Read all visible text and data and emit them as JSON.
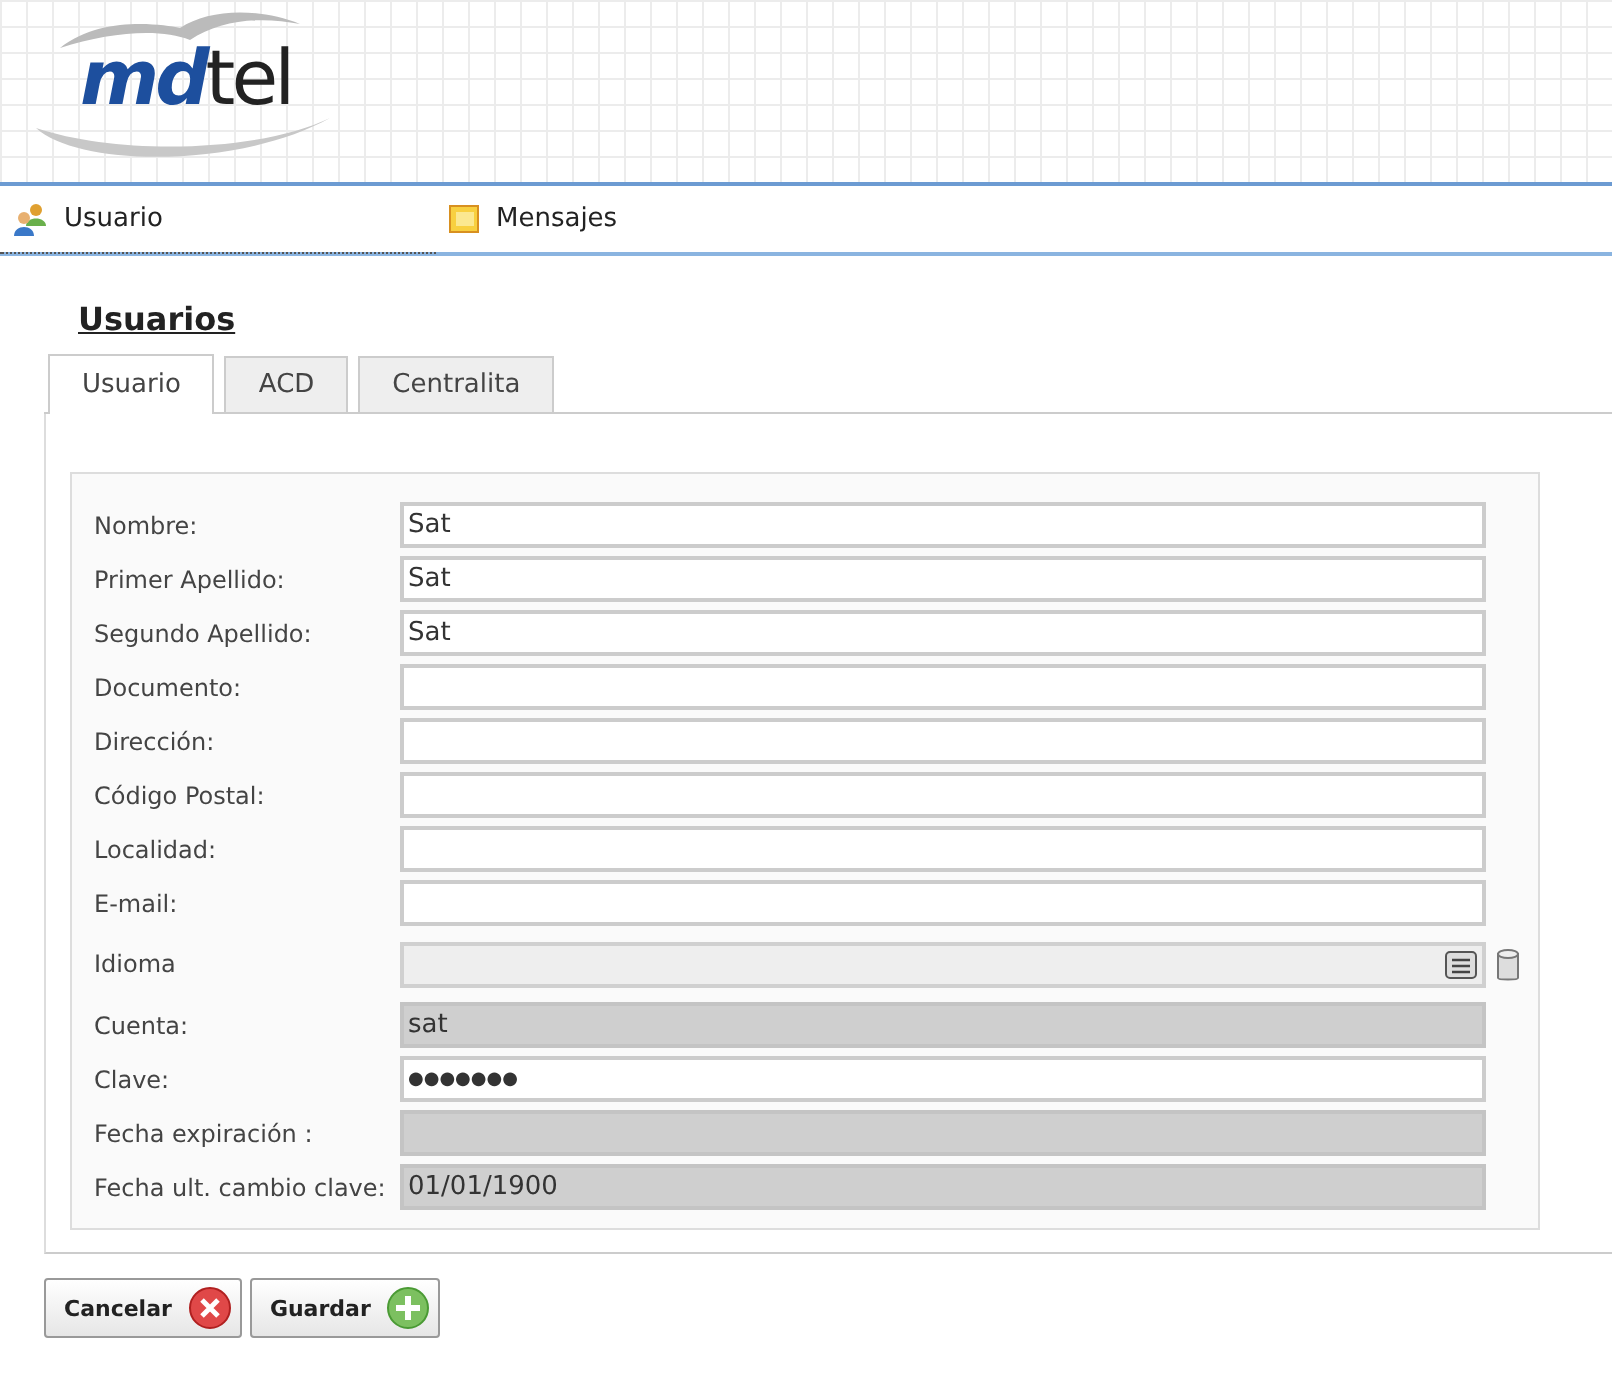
{
  "logo": {
    "part_1": "md",
    "part_2": "tel"
  },
  "nav": [
    {
      "label": "Usuario",
      "kind": "users",
      "selected": true
    },
    {
      "label": "Mensajes",
      "kind": "message",
      "selected": false
    }
  ],
  "title": "Usuarios",
  "tabs": [
    {
      "label": "Usuario",
      "selected": true
    },
    {
      "label": "ACD",
      "selected": false
    },
    {
      "label": "Centralita",
      "selected": false
    }
  ],
  "fields": [
    {
      "label": "Nombre:",
      "value": "Sat",
      "kind": "text"
    },
    {
      "label": "Primer Apellido:",
      "value": "Sat",
      "kind": "text"
    },
    {
      "label": "Segundo Apellido:",
      "value": "Sat",
      "kind": "text"
    },
    {
      "label": "Documento:",
      "kind": "text"
    },
    {
      "label": "Dirección:",
      "kind": "text"
    },
    {
      "label": "Código Postal:",
      "kind": "text"
    },
    {
      "label": "Localidad:",
      "kind": "text"
    },
    {
      "label": "E-mail:",
      "kind": "text"
    },
    {
      "label": "Idioma",
      "kind": "lookup"
    },
    {
      "label": "Cuenta:",
      "value": "sat",
      "kind": "readonly"
    },
    {
      "label": "Clave:",
      "value": "●●●●●●●",
      "kind": "password"
    },
    {
      "label": "Fecha expiración :",
      "kind": "readonly"
    },
    {
      "label": "Fecha ult. cambio clave:",
      "value": "01/01/1900",
      "kind": "readonly"
    }
  ],
  "buttons": [
    {
      "label": "Cancelar",
      "kind": "cancel"
    },
    {
      "label": "Guardar",
      "kind": "save"
    }
  ]
}
